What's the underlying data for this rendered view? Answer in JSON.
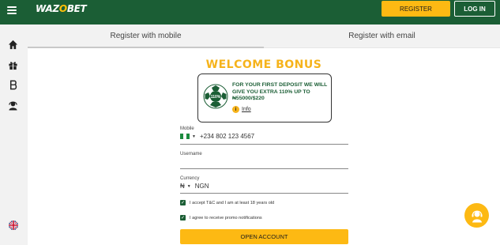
{
  "header": {
    "logo_text_a": "WAZ",
    "logo_text_o": "O",
    "logo_text_b": "BET",
    "register_label": "REGISTER",
    "login_label": "LOG IN"
  },
  "rail": {
    "icons": [
      "home-icon",
      "gift-icon",
      "betting-b-icon",
      "agent-icon"
    ],
    "language_icon": "uk-flag-icon"
  },
  "tabs": {
    "mobile": "Register with mobile",
    "email": "Register with email"
  },
  "bonus": {
    "title": "WELCOME BONUS",
    "badge": "110%",
    "text": "FOR YOUR FIRST DEPOSIT WE WILL GIVE YOU EXTRA 110% UP TO ₦55000/$220",
    "info_icon": "i",
    "info_label": "Info"
  },
  "form": {
    "mobile_label": "Mobile",
    "mobile_placeholder": "+234 802 123 4567",
    "username_label": "Username",
    "username_value": "",
    "currency_label": "Currency",
    "currency_symbol": "₦",
    "currency_value": "NGN",
    "accept_terms": "I accept T&C and I am at least 18 years old",
    "promo_notifications": "I agree to receive promo notifications",
    "submit_label": "OPEN ACCOUNT"
  },
  "colors": {
    "brand_green": "#1b5e35",
    "accent_yellow": "#fdb913",
    "title_yellow": "#f6b31b"
  }
}
